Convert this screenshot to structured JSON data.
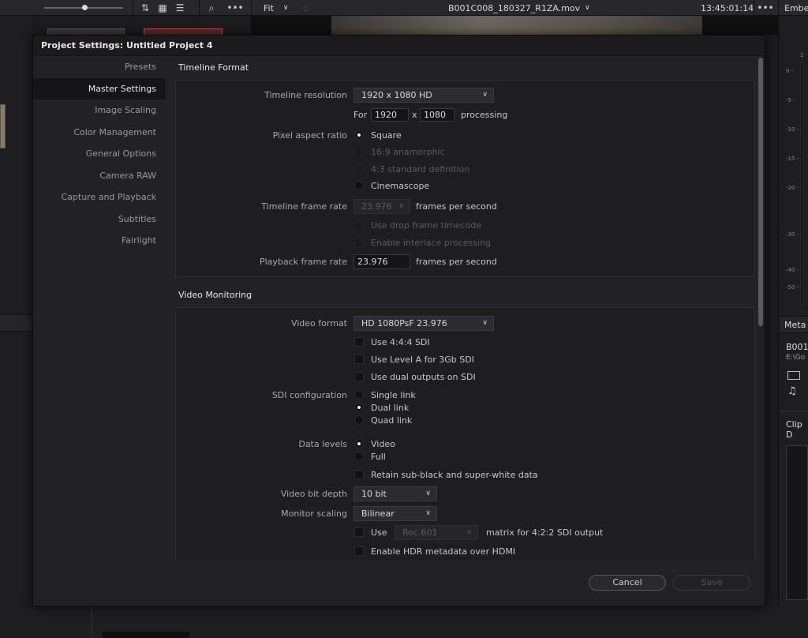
{
  "topbar": {
    "zoom_label": "Fit",
    "clip_name": "B001C008_180327_R1ZA.mov",
    "timecode": "13:45:01:14",
    "right_panel_title": "Embe"
  },
  "right_panel": {
    "meter_ticks": [
      "1",
      "0 -",
      "-5 -",
      "-10 -",
      "-15 -",
      "-20 -",
      "-30 -",
      "-40 -",
      "-50 -"
    ],
    "metadata_title": "Meta",
    "clip_name_short": "B001C",
    "clip_path_short": "E:\\Go",
    "clip_details_label": "Clip D"
  },
  "dialog": {
    "title": "Project Settings:  Untitled Project 4",
    "nav": [
      {
        "label": "Presets",
        "active": false
      },
      {
        "label": "Master Settings",
        "active": true
      },
      {
        "label": "Image Scaling",
        "active": false
      },
      {
        "label": "Color Management",
        "active": false
      },
      {
        "label": "General Options",
        "active": false
      },
      {
        "label": "Camera RAW",
        "active": false
      },
      {
        "label": "Capture and Playback",
        "active": false
      },
      {
        "label": "Subtitles",
        "active": false
      },
      {
        "label": "Fairlight",
        "active": false
      }
    ],
    "timeline_format": {
      "section_title": "Timeline Format",
      "resolution_label": "Timeline resolution",
      "resolution_value": "1920 x 1080 HD",
      "for_label": "For",
      "width_value": "1920",
      "x_label": "x",
      "height_value": "1080",
      "processing_label": "processing",
      "par_label": "Pixel aspect ratio",
      "par_options": [
        {
          "label": "Square",
          "selected": true,
          "disabled": false
        },
        {
          "label": "16:9 anamorphic",
          "selected": false,
          "disabled": true
        },
        {
          "label": "4:3 standard definition",
          "selected": false,
          "disabled": true
        },
        {
          "label": "Cinemascope",
          "selected": false,
          "disabled": false
        }
      ],
      "frame_rate_label": "Timeline frame rate",
      "frame_rate_value": "23.976",
      "fps_label": "frames per second",
      "drop_frame_label": "Use drop frame timecode",
      "interlace_label": "Enable interlace processing",
      "playback_rate_label": "Playback frame rate",
      "playback_rate_value": "23.976",
      "playback_fps_label": "frames per second"
    },
    "video_monitoring": {
      "section_title": "Video Monitoring",
      "video_format_label": "Video format",
      "video_format_value": "HD 1080PsF 23.976",
      "use_444_label": "Use 4:4:4 SDI",
      "level_a_label": "Use Level A for 3Gb SDI",
      "dual_outputs_label": "Use dual outputs on SDI",
      "sdi_config_label": "SDI configuration",
      "sdi_options": [
        {
          "label": "Single link",
          "selected": false
        },
        {
          "label": "Dual link",
          "selected": true
        },
        {
          "label": "Quad link",
          "selected": false
        }
      ],
      "data_levels_label": "Data levels",
      "data_level_options": [
        {
          "label": "Video",
          "selected": true
        },
        {
          "label": "Full",
          "selected": false
        }
      ],
      "retain_label": "Retain sub-black and super-white data",
      "bit_depth_label": "Video bit depth",
      "bit_depth_value": "10 bit",
      "scaling_label": "Monitor scaling",
      "scaling_value": "Bilinear",
      "use_label": "Use",
      "matrix_value": "Rec.601",
      "matrix_suffix": "matrix for 4:2:2 SDI output",
      "hdr_label": "Enable HDR metadata over HDMI"
    },
    "buttons": {
      "cancel": "Cancel",
      "save": "Save"
    }
  }
}
